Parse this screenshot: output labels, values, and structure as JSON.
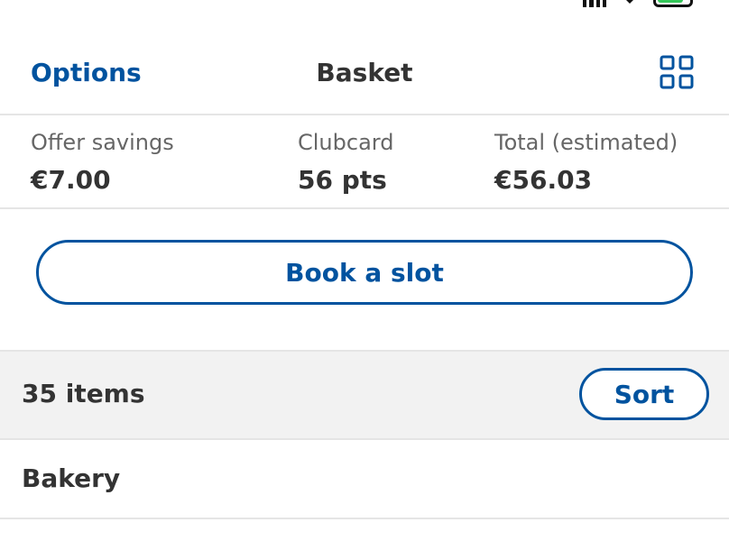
{
  "nav": {
    "options_label": "Options",
    "title": "Basket",
    "grid_icon": "grid-icon"
  },
  "summary": {
    "offer_savings_label": "Offer savings",
    "offer_savings_value": "€7.00",
    "clubcard_label": "Clubcard",
    "clubcard_value": "56 pts",
    "total_label": "Total (estimated)",
    "total_value": "€56.03"
  },
  "book_slot_label": "Book a slot",
  "items_bar": {
    "count_label": "35 items",
    "sort_label": "Sort"
  },
  "sections": [
    {
      "title": "Bakery"
    }
  ],
  "colors": {
    "brand_blue": "#00539f",
    "text_dark": "#333333",
    "text_muted": "#666666",
    "divider": "#e5e5e5",
    "bar_background": "#f2f2f2",
    "battery_green": "#34c759"
  }
}
